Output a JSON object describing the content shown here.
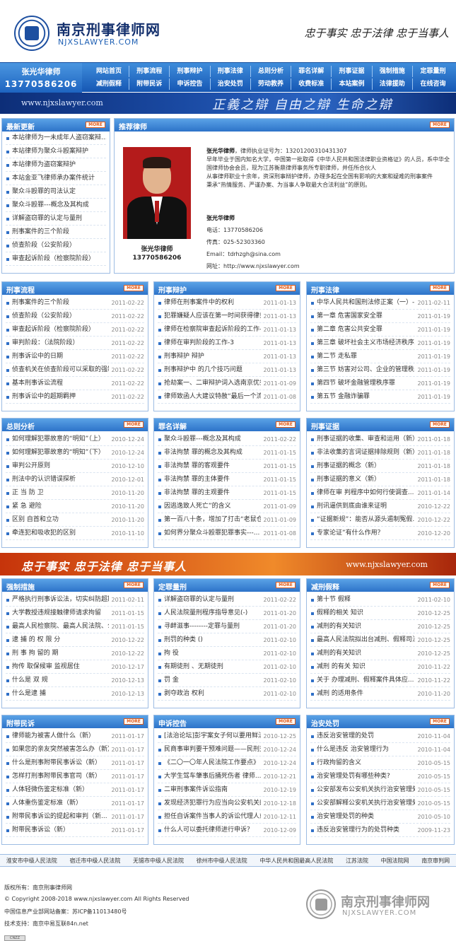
{
  "header": {
    "site_cn": "南京刑事律师网",
    "site_en": "NJXSLAWYER.COM",
    "slogan": "忠于事实 忠于法律 忠于当事人"
  },
  "nav": {
    "lawyer_name": "张光华律师",
    "lawyer_phone": "13770586206",
    "row1": [
      "网站首页",
      "刑事流程",
      "刑事辩护",
      "刑事法律",
      "总则分析",
      "罪名详解",
      "刑事证据",
      "强制措施",
      "定罪量刑"
    ],
    "row2": [
      "减刑假释",
      "附带民诉",
      "申诉控告",
      "治安处罚",
      "劳动教养",
      "收费标准",
      "本站案例",
      "法律援助",
      "在线咨询"
    ]
  },
  "banner": {
    "url": "www.njxslawyer.com",
    "motto": "正義之辯 自由之辯 生命之辯"
  },
  "more": "MORE",
  "latest": {
    "title": "最新更新",
    "items": [
      "本站律师为一未成年人盗窃案辩...",
      "本站律师为聚众斗殴案辩护",
      "本站律师为盗窃案辩护",
      "本站金亚飞律师承办案件统计",
      "聚众斗殴罪的司法认定",
      "聚众斗殴罪---概念及其构成",
      "详解盗窃罪的认定与量刑",
      "刑事案件的三个阶段",
      "侦查阶段（公安阶段）",
      "审查起诉阶段（检察院阶段）"
    ]
  },
  "recommend": {
    "title": "推荐律师",
    "name": "张光华律师",
    "phone": "13770586206",
    "intro_name": "张光华律师",
    "intro_rest": "，律师执业证号为：13201200310431307",
    "intro": "早年毕业于国内知名大学，中国第一批取得《中华人民共和国法律职业资格证》的人员，系中华全国律师协会会员，现为江苏衡鼎律师事务所专职律师，并任所合伙人",
    "intro2": "从事律师职业十余年，资深刑事辩护律师，办理多起在全国有影响的大案和疑难的刑事案件",
    "intro3": "秉承“热情服务、严谨办案、为当事人争取最大合法利益”的原则。",
    "c_name": "张光华律师",
    "c_tel": "电话：13770586206",
    "c_fax": "传真：025-52303360",
    "c_mail": "Email：tdrhzgh@sina.com",
    "c_web": "网址：http://www.njxslawyer.com"
  },
  "sections": [
    {
      "title": "刑事流程",
      "items": [
        [
          "刑事案件的三个阶段",
          "2011-02-22"
        ],
        [
          "侦查阶段（公安阶段）",
          "2011-02-22"
        ],
        [
          "审查起诉阶段（检察院阶段）",
          "2011-02-22"
        ],
        [
          "审判阶段：（法院阶段）",
          "2011-02-22"
        ],
        [
          "刑事诉讼中的日期",
          "2011-02-22"
        ],
        [
          "侦查机关在侦查阶段可以采取的强制...",
          "2011-02-22"
        ],
        [
          "基本刑事诉讼流程",
          "2011-02-22"
        ],
        [
          "刑事诉讼中的超期羁押",
          "2011-02-22"
        ]
      ]
    },
    {
      "title": "刑事辩护",
      "items": [
        [
          "律师在刑事案件中的权利",
          "2011-01-13"
        ],
        [
          "犯罪嫌疑人应该在第一时间获得律师...",
          "2011-01-13"
        ],
        [
          "律师在检察院审查起诉阶段的工作-...",
          "2011-01-13"
        ],
        [
          "律师在审判阶段的工作-3",
          "2011-01-13"
        ],
        [
          "刑事辩护 辩护",
          "2011-01-13"
        ],
        [
          "刑事辩护中 的几个技巧问题",
          "2011-01-13"
        ],
        [
          "抢劫案一、二审辩护词入选南京优秀...",
          "2011-01-09"
        ],
        [
          "律师致函人大建议特赦“最后一个流...",
          "2011-01-08"
        ]
      ]
    },
    {
      "title": "刑事法律",
      "items": [
        [
          "中华人民共和国刑法修正案（一）-...",
          "2011-02-11"
        ],
        [
          "第一章 危害国家安全罪",
          "2011-01-19"
        ],
        [
          "第二章 危害公共安全罪",
          "2011-01-19"
        ],
        [
          "第三章 破坏社会主义市场经济秩序...",
          "2011-01-19"
        ],
        [
          "第二节 走私罪",
          "2011-01-19"
        ],
        [
          "第三节 妨害对公司、企业的管理秩...",
          "2011-01-19"
        ],
        [
          "第四节 破坏金融管理秩序罪",
          "2011-01-19"
        ],
        [
          "第五节 金融诈骗罪",
          "2011-01-19"
        ]
      ]
    },
    {
      "title": "总则分析",
      "items": [
        [
          "如何理解犯罪故意的“明知”（上）",
          "2010-12-24"
        ],
        [
          "如何理解犯罪故意的“明知”（下）",
          "2010-12-24"
        ],
        [
          "审判公开原则",
          "2010-12-10"
        ],
        [
          "刑法中的认识错误探析",
          "2010-12-01"
        ],
        [
          "正 当 防 卫",
          "2010-11-20"
        ],
        [
          "紧 急 避险",
          "2010-11-20"
        ],
        [
          "区别 自首和立功",
          "2010-11-20"
        ],
        [
          "牵连犯和吸收犯的区别",
          "2010-11-10"
        ]
      ]
    },
    {
      "title": "罪名详解",
      "items": [
        [
          "聚众斗殴罪---概念及其构成",
          "2011-02-22"
        ],
        [
          "非法拘禁 罪的概念及其构成",
          "2011-01-15"
        ],
        [
          "非法拘禁 罪的客观要件",
          "2011-01-15"
        ],
        [
          "非法拘禁 罪的主体要件",
          "2011-01-15"
        ],
        [
          "非法拘禁 罪的主观要件",
          "2011-01-15"
        ],
        [
          "因逃逸致人死亡”的含义",
          "2011-01-09"
        ],
        [
          "第一百八十条，增加了打击“老鼠仓...",
          "2011-01-09"
        ],
        [
          "如何界分聚众斗殴罪犯罪事实---...",
          "2011-01-08"
        ]
      ]
    },
    {
      "title": "刑事证据",
      "items": [
        [
          "刑事证据的收集、审查和运用（新）",
          "2011-01-18"
        ],
        [
          "非法收集的言词证据排除规则（新）",
          "2011-01-18"
        ],
        [
          "刑事证据的概念（新）",
          "2011-01-18"
        ],
        [
          "刑事证据的意义（新）",
          "2011-01-18"
        ],
        [
          "律师在审 判程序中如何行使调查...",
          "2011-01-14"
        ],
        [
          "刑讯逼供到底由谁来证明",
          "2010-12-22"
        ],
        [
          "“证据新规”：能否从源头遏制冤假...",
          "2010-12-22"
        ],
        [
          "专家论证”有什么作用？",
          "2010-12-20"
        ]
      ]
    },
    {
      "title": "强制措施",
      "items": [
        [
          "严格执行刑事诉讼法，切实纠防超期...",
          "2011-02-11"
        ],
        [
          "大学教授违规接触律师请求拘留",
          "2011-01-15"
        ],
        [
          "最高人民检察院、最高人民法院、公...",
          "2011-01-15"
        ],
        [
          "逮 捕 的 权 限 分",
          "2010-12-22"
        ],
        [
          "刑 事 拘 留的 期",
          "2010-12-22"
        ],
        [
          "拘传 取保候审 监视居住",
          "2010-12-17"
        ],
        [
          "什么是 双 规",
          "2010-12-13"
        ],
        [
          "什么是逮 捕",
          "2010-12-13"
        ]
      ]
    },
    {
      "title": "定罪量刑",
      "items": [
        [
          "详解盗窃罪的认定与量刑",
          "2011-02-22"
        ],
        [
          "人民法院量刑程序指导意见(-)",
          "2011-01-20"
        ],
        [
          "寻衅滋事--------定罪与量刑",
          "2011-01-20"
        ],
        [
          "刑罚的种类 ()",
          "2011-02-10"
        ],
        [
          "拘 役",
          "2011-02-10"
        ],
        [
          "有期徒刑 、无期徒刑",
          "2011-02-10"
        ],
        [
          "罚 金",
          "2011-02-10"
        ],
        [
          "剥夺政治 权利",
          "2011-02-10"
        ]
      ]
    },
    {
      "title": "减刑假释",
      "items": [
        [
          "第十节 假释",
          "2011-02-10"
        ],
        [
          "假释的相关 知识",
          "2010-12-25"
        ],
        [
          "减刑的有关知识",
          "2010-12-25"
        ],
        [
          "最高人民法院拟出台减刑、假释司法...",
          "2010-12-25"
        ],
        [
          "减刑的有关知识",
          "2010-12-25"
        ],
        [
          "减刑 的有关 知识",
          "2010-11-22"
        ],
        [
          "关于 办理减刑、假释案件具体应...",
          "2010-11-22"
        ],
        [
          "减刑 的适用条件",
          "2010-11-20"
        ]
      ]
    },
    {
      "title": "附带民诉",
      "items": [
        [
          "律师能为被害人做什么（新）",
          "2011-01-17"
        ],
        [
          "如果您的亲友突然被害怎么办（新）",
          "2011-01-17"
        ],
        [
          "什么是刑事附带民事诉讼（新）",
          "2011-01-17"
        ],
        [
          "怎样打刑事附带民事官司（新）",
          "2011-01-17"
        ],
        [
          "人体轻微伤鉴定标准（新）",
          "2011-01-17"
        ],
        [
          "人体重伤鉴定标准（新）",
          "2011-01-17"
        ],
        [
          "附带民事诉讼的提起和审判（新...",
          "2011-01-17"
        ],
        [
          "附带民事诉讼（新）",
          "2011-01-17"
        ]
      ]
    },
    {
      "title": "申诉控告",
      "items": [
        [
          "[法治论坛]彭宇案女子何以要用鲜活...",
          "2010-12-25"
        ],
        [
          "民商事审判要干预难问题——民刑交...",
          "2010-12-24"
        ],
        [
          "《二〇一〇年人民法院工作要点》",
          "2010-12-24"
        ],
        [
          "大学生驾车肇事后捅死伤者 律师...",
          "2010-12-21"
        ],
        [
          "二审刑事案件诉讼指南",
          "2010-12-19"
        ],
        [
          "发现经济犯罪行为应当向公安机关的...",
          "2010-12-18"
        ],
        [
          "担任自诉案件当事人的诉讼代理人或...",
          "2010-12-11"
        ],
        [
          "什么人可以委托律师进行申诉？",
          "2010-12-09"
        ]
      ]
    },
    {
      "title": "治安处罚",
      "items": [
        [
          "违反治安管理的处罚",
          "2010-11-04"
        ],
        [
          "什么是违反 治安管理行为",
          "2010-11-04"
        ],
        [
          "行政拘留的含义",
          "2010-05-15"
        ],
        [
          "治安管理处罚有哪些种类?",
          "2010-05-15"
        ],
        [
          "公安部发布公安机关执行治安管理处...",
          "2010-05-15"
        ],
        [
          "公安部解释公安机关执行治安管理处...",
          "2010-05-15"
        ],
        [
          "治安管理处罚的种类",
          "2010-05-10"
        ],
        [
          "违反治安管理行为的处罚种类",
          "2009-11-23"
        ]
      ]
    }
  ],
  "strip": {
    "motto": "忠于事实 忠于法律 忠于当事人",
    "url": "www.njxslawyer.com"
  },
  "links": [
    "淮安市中级人民法院",
    "宿迁市中级人民法院",
    "无锡市中级人民法院",
    "徐州市中级人民法院",
    "中华人民共和国最高人民法院",
    "江苏法院",
    "中国法院网",
    "南京审判网"
  ],
  "footer": {
    "l1": "版权所有：南京刑事律师网",
    "l2": "© Copyright 2008-2018 www.njxslawyer.com All Rights Reserved",
    "l3": "中国信息产业部网站备案：苏ICP备11013480号",
    "l4": "技术支持：南京中易互联84n.net",
    "fcn": "南京刑事律师网",
    "fen": "NJXSLAWYER.COM",
    "cnzz": "CNZZ"
  }
}
